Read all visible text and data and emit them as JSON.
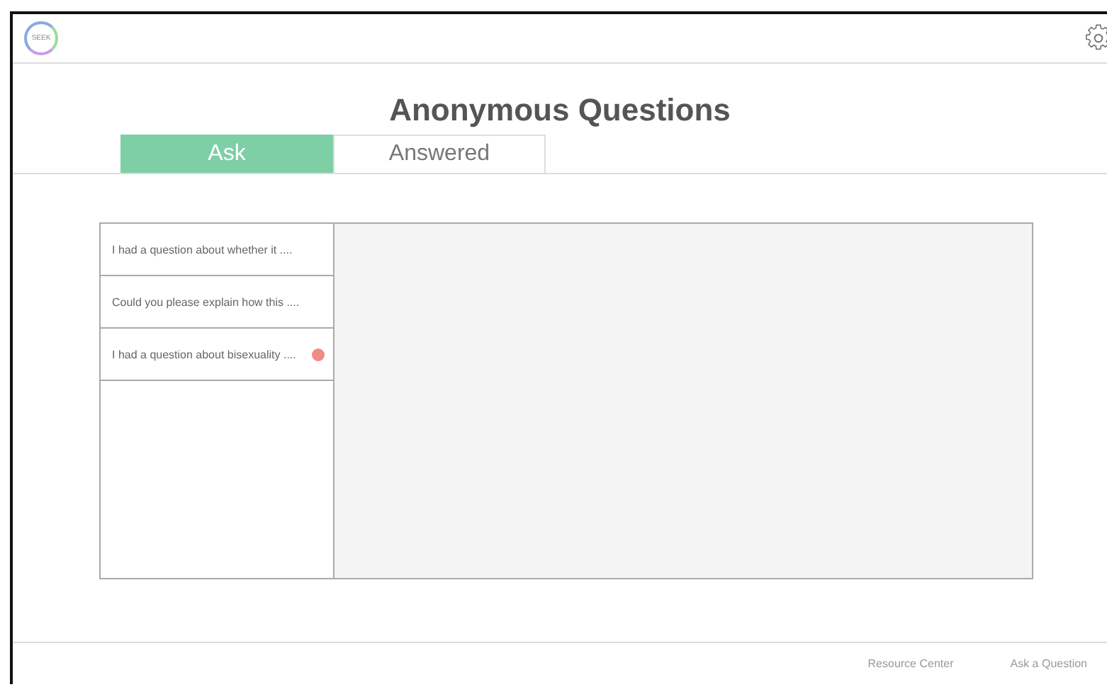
{
  "header": {
    "logo": "SEEK"
  },
  "title": "Anonymous Questions",
  "tabs": [
    {
      "label": "Ask",
      "selected": true
    },
    {
      "label": "Answered",
      "selected": false
    }
  ],
  "questions": [
    {
      "text": "I had a question about whether it ....",
      "unread": false
    },
    {
      "text": "Could you please explain how this ....",
      "unread": false
    },
    {
      "text": "I had a question about bisexuality ....",
      "unread": true
    }
  ],
  "footer": {
    "links": [
      "Resource Center",
      "Ask a Question"
    ]
  }
}
